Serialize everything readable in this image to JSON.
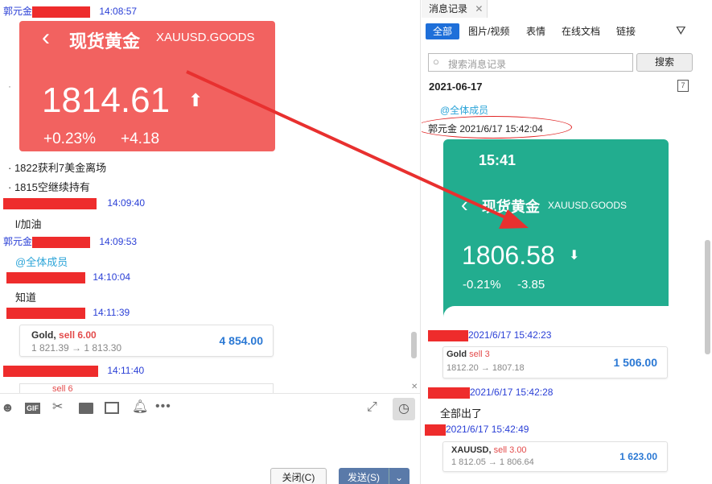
{
  "left": {
    "messages": [
      {
        "sender": "郭元金",
        "time": "14:08:57"
      },
      {
        "sender": "",
        "time": "14:09:40"
      },
      {
        "sender": "郭元金",
        "time": "14:09:53"
      },
      {
        "sender": "",
        "time": "14:10:04"
      },
      {
        "sender": "",
        "time": "14:11:39"
      },
      {
        "sender": "",
        "time": "14:11:40"
      }
    ],
    "card": {
      "title": "现货黄金",
      "symbol": "XAUUSD.GOODS",
      "price": "1814.61",
      "pct": "+0.23%",
      "chg": "+4.18"
    },
    "text1": "1822获利7美金离场",
    "text2": "1815空继续持有",
    "text3": "l/加油",
    "mention": "@全体成员",
    "text4": "知道",
    "trade": {
      "name": "Gold,",
      "side": "sell 6.00",
      "prices": "1 821.39 → 1 813.30",
      "amount": "4 854.00"
    },
    "partial": "sell 6",
    "close_label": "关闭(C)",
    "send_label": "发送(S)"
  },
  "right": {
    "title": "消息记录",
    "tabs": [
      "全部",
      "图片/视频",
      "表情",
      "在线文档",
      "链接"
    ],
    "search_placeholder": "搜索消息记录",
    "search_button": "搜索",
    "date": "2021-06-17",
    "mention": "@全体成员",
    "header_line": "郭元金 2021/6/17 15:42:04",
    "card": {
      "clock": "15:41",
      "title": "现货黄金",
      "symbol": "XAUUSD.GOODS",
      "price": "1806.58",
      "pct": "-0.21%",
      "chg": "-3.85"
    },
    "msg2_time": "2021/6/17 15:42:23",
    "trade1": {
      "name": "Gold",
      "side": "sell 3",
      "prices": "1812.20 → 1807.18",
      "amount": "1 506.00"
    },
    "msg3_time": "2021/6/17 15:42:28",
    "msg3_text": "全部出了",
    "msg4_time": "2021/6/17 15:42:49",
    "trade2": {
      "name": "XAUUSD,",
      "side": "sell 3.00",
      "prices": "1 812.05 → 1 806.64",
      "amount": "1 623.00"
    }
  },
  "colors": {
    "accent": "#1e6fd9",
    "redact": "#ee2c2c",
    "red_card": "#f26260",
    "green_card": "#22ad8f",
    "arrow": "#e8302f"
  }
}
